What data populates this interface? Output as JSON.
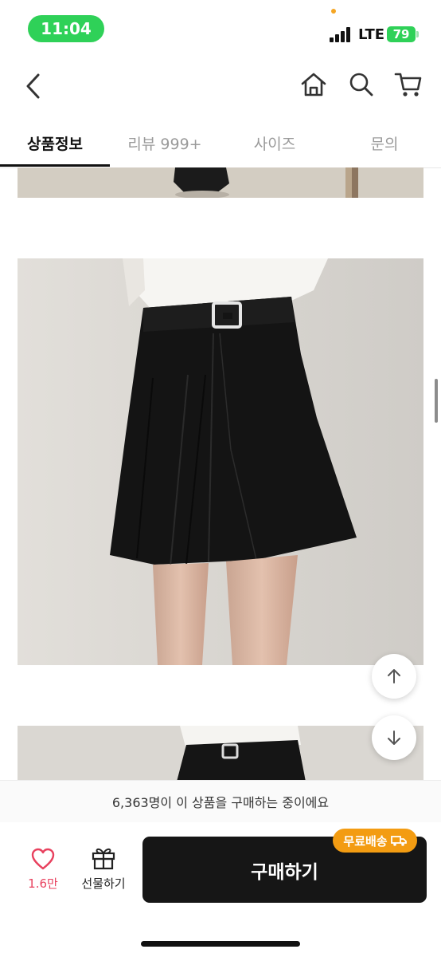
{
  "status": {
    "time": "11:04",
    "network": "LTE",
    "battery": "79"
  },
  "nav": {
    "back_icon": "chevron-left-icon",
    "home_icon": "home-icon",
    "search_icon": "search-icon",
    "cart_icon": "cart-icon"
  },
  "tabs": [
    {
      "label": "상품정보",
      "active": true
    },
    {
      "label": "리뷰 999+",
      "active": false
    },
    {
      "label": "사이즈",
      "active": false
    },
    {
      "label": "문의",
      "active": false
    }
  ],
  "purchase_info": "6,363명이 이 상품을 구매하는 중이에요",
  "bottom": {
    "like_count": "1.6만",
    "gift_label": "선물하기",
    "buy_label": "구매하기",
    "free_shipping": "무료배송"
  },
  "colors": {
    "accent_green": "#2fd158",
    "buy_button": "#161616",
    "badge_orange": "#f39c12",
    "like_pink": "#e8415e"
  }
}
